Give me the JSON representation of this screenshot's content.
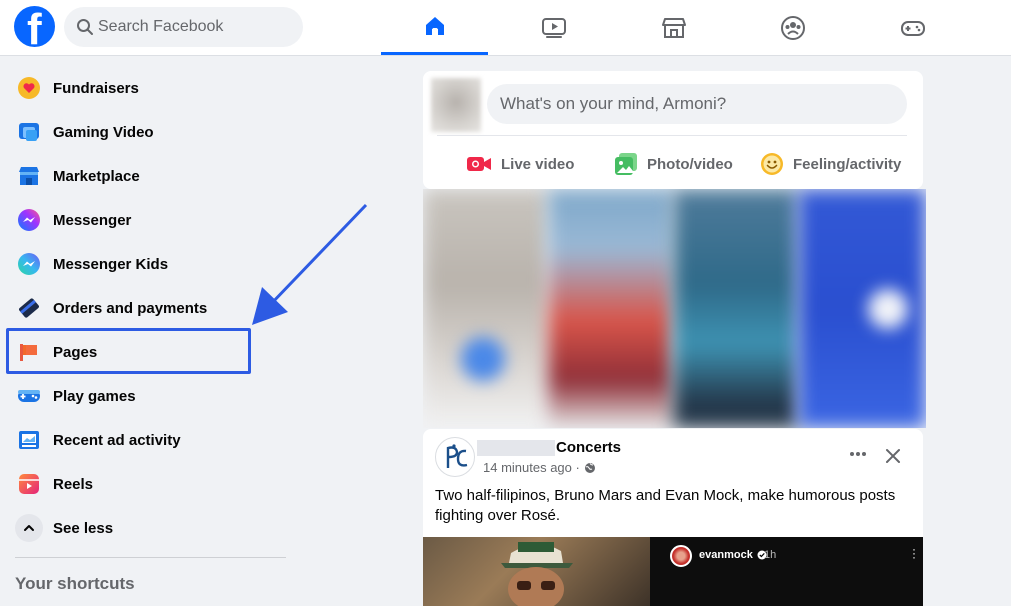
{
  "header": {
    "logo_letter": "f",
    "search_placeholder": "Search Facebook",
    "nav_tabs": [
      {
        "name": "home",
        "icon": "home-icon",
        "active": true
      },
      {
        "name": "watch",
        "icon": "video-icon",
        "active": false
      },
      {
        "name": "marketplace",
        "icon": "store-icon",
        "active": false
      },
      {
        "name": "groups",
        "icon": "groups-icon",
        "active": false
      },
      {
        "name": "gaming",
        "icon": "gamepad-icon",
        "active": false
      }
    ]
  },
  "sidebar": {
    "items": [
      {
        "label": "Fundraisers",
        "icon": "heart-icon"
      },
      {
        "label": "Gaming Video",
        "icon": "gaming-video-icon"
      },
      {
        "label": "Marketplace",
        "icon": "marketplace-icon"
      },
      {
        "label": "Messenger",
        "icon": "messenger-icon"
      },
      {
        "label": "Messenger Kids",
        "icon": "messenger-kids-icon"
      },
      {
        "label": "Orders and payments",
        "icon": "card-icon"
      },
      {
        "label": "Pages",
        "icon": "flag-icon"
      },
      {
        "label": "Play games",
        "icon": "controller-icon"
      },
      {
        "label": "Recent ad activity",
        "icon": "ad-activity-icon"
      },
      {
        "label": "Reels",
        "icon": "reels-icon"
      },
      {
        "label": "See less",
        "icon": "chevron-up-icon"
      }
    ],
    "shortcuts_title": "Your shortcuts"
  },
  "composer": {
    "placeholder": "What's on your mind, Armoni?",
    "actions": [
      {
        "label": "Live video",
        "icon": "live-video-icon"
      },
      {
        "label": "Photo/video",
        "icon": "photo-icon"
      },
      {
        "label": "Feeling/activity",
        "icon": "smiley-icon"
      }
    ]
  },
  "post": {
    "name": "Concerts",
    "time": "14 minutes ago ·",
    "text": "Two half-filipinos, Bruno Mars and Evan Mock, make humorous posts fighting over Rosé.",
    "embed_username": "evanmock",
    "embed_time": "1h"
  },
  "colors": {
    "brand": "#0866ff",
    "annotation": "#2d5be3"
  }
}
